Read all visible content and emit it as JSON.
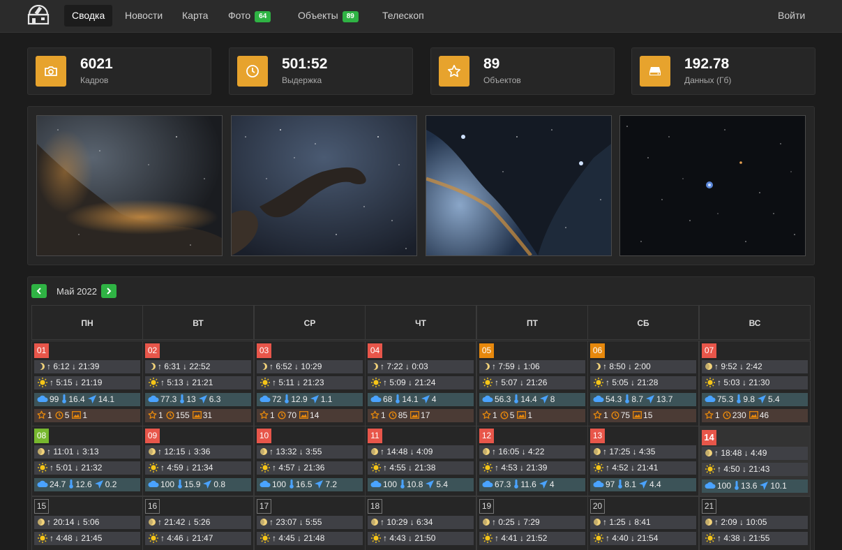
{
  "nav": {
    "items": [
      {
        "label": "Сводка",
        "active": true
      },
      {
        "label": "Новости"
      },
      {
        "label": "Карта"
      },
      {
        "label": "Фото",
        "badge": "64"
      },
      {
        "label": "Объекты",
        "badge": "89"
      },
      {
        "label": "Телескоп"
      }
    ],
    "login": "Войти"
  },
  "stats": [
    {
      "icon": "camera-icon",
      "value": "6021",
      "label": "Кадров"
    },
    {
      "icon": "clock-icon",
      "value": "501:52",
      "label": "Выдержка"
    },
    {
      "icon": "star-icon",
      "value": "89",
      "label": "Объектов"
    },
    {
      "icon": "hdd-icon",
      "value": "192.78",
      "label": "Данных (Гб)"
    }
  ],
  "gallery": [
    {
      "icon": "nebula-photo-cygnus-wall"
    },
    {
      "icon": "nebula-photo-elephant-trunk"
    },
    {
      "icon": "nebula-photo-pelican"
    },
    {
      "icon": "nebula-photo-starfield"
    }
  ],
  "calendar": {
    "month": "Май 2022",
    "weekdays": [
      "ПН",
      "ВТ",
      "СР",
      "ЧТ",
      "ПТ",
      "СБ",
      "ВС"
    ],
    "colors": {
      "accent": "#2fb344",
      "moon_row": "#3f4045",
      "weather_row": "#3c5358",
      "stats_row": "#4b3b35",
      "sun": "#f5c518",
      "cloud": "#4aa3ff",
      "star": "#e7880c"
    },
    "weeks": [
      [
        {
          "day": "01",
          "status": "red",
          "moon": "↑ 6:12 ↓ 21:39",
          "sun": "↑ 5:15 ↓ 21:19",
          "cloud": "99",
          "temp": "16.4",
          "wind": "14.1",
          "objects": "1",
          "hours": "5",
          "photos": "1"
        },
        {
          "day": "02",
          "status": "red",
          "moon": "↑ 6:31 ↓ 22:52",
          "sun": "↑ 5:13 ↓ 21:21",
          "cloud": "77.3",
          "temp": "13",
          "wind": "6.3",
          "objects": "1",
          "hours": "155",
          "photos": "31"
        },
        {
          "day": "03",
          "status": "red",
          "moon": "↑ 6:52 ↓ 10:29",
          "sun": "↑ 5:11 ↓ 21:23",
          "cloud": "72",
          "temp": "12.9",
          "wind": "1.1",
          "objects": "1",
          "hours": "70",
          "photos": "14"
        },
        {
          "day": "04",
          "status": "red",
          "moon": "↑ 7:22 ↓ 0:03",
          "sun": "↑ 5:09 ↓ 21:24",
          "cloud": "68",
          "temp": "14.1",
          "wind": "4",
          "objects": "1",
          "hours": "85",
          "photos": "17"
        },
        {
          "day": "05",
          "status": "orange",
          "moon": "↑ 7:59 ↓ 1:06",
          "sun": "↑ 5:07 ↓ 21:26",
          "cloud": "56.3",
          "temp": "14.4",
          "wind": "8",
          "objects": "1",
          "hours": "5",
          "photos": "1"
        },
        {
          "day": "06",
          "status": "orange",
          "moon": "↑ 8:50 ↓ 2:00",
          "sun": "↑ 5:05 ↓ 21:28",
          "cloud": "54.3",
          "temp": "8.7",
          "wind": "13.7",
          "objects": "1",
          "hours": "75",
          "photos": "15"
        },
        {
          "day": "07",
          "status": "red",
          "moon": "↑ 9:52 ↓ 2:42",
          "sun": "↑ 5:03 ↓ 21:30",
          "cloud": "75.3",
          "temp": "9.8",
          "wind": "5.4",
          "objects": "1",
          "hours": "230",
          "photos": "46"
        }
      ],
      [
        {
          "day": "08",
          "status": "green",
          "moon": "↑ 11:01 ↓ 3:13",
          "sun": "↑ 5:01 ↓ 21:32",
          "cloud": "24.7",
          "temp": "12.6",
          "wind": "0.2"
        },
        {
          "day": "09",
          "status": "red",
          "moon": "↑ 12:15 ↓ 3:36",
          "sun": "↑ 4:59 ↓ 21:34",
          "cloud": "100",
          "temp": "15.9",
          "wind": "0.8"
        },
        {
          "day": "10",
          "status": "red",
          "moon": "↑ 13:32 ↓ 3:55",
          "sun": "↑ 4:57 ↓ 21:36",
          "cloud": "100",
          "temp": "16.5",
          "wind": "7.2"
        },
        {
          "day": "11",
          "status": "red",
          "moon": "↑ 14:48 ↓ 4:09",
          "sun": "↑ 4:55 ↓ 21:38",
          "cloud": "100",
          "temp": "10.8",
          "wind": "5.4"
        },
        {
          "day": "12",
          "status": "red",
          "moon": "↑ 16:05 ↓ 4:22",
          "sun": "↑ 4:53 ↓ 21:39",
          "cloud": "67.3",
          "temp": "11.6",
          "wind": "4"
        },
        {
          "day": "13",
          "status": "red",
          "moon": "↑ 17:25 ↓ 4:35",
          "sun": "↑ 4:52 ↓ 21:41",
          "cloud": "97",
          "temp": "8.1",
          "wind": "4.4"
        },
        {
          "day": "14",
          "status": "today",
          "moon": "↑ 18:48 ↓ 4:49",
          "sun": "↑ 4:50 ↓ 21:43",
          "cloud": "100",
          "temp": "13.6",
          "wind": "10.1"
        }
      ],
      [
        {
          "day": "15",
          "status": "plain",
          "moon": "↑ 20:14 ↓ 5:06",
          "sun": "↑ 4:48 ↓ 21:45"
        },
        {
          "day": "16",
          "status": "plain",
          "moon": "↑ 21:42 ↓ 5:26",
          "sun": "↑ 4:46 ↓ 21:47"
        },
        {
          "day": "17",
          "status": "plain",
          "moon": "↑ 23:07 ↓ 5:55",
          "sun": "↑ 4:45 ↓ 21:48"
        },
        {
          "day": "18",
          "status": "plain",
          "moon": "↑ 10:29 ↓ 6:34",
          "sun": "↑ 4:43 ↓ 21:50"
        },
        {
          "day": "19",
          "status": "plain",
          "moon": "↑ 0:25 ↓ 7:29",
          "sun": "↑ 4:41 ↓ 21:52"
        },
        {
          "day": "20",
          "status": "plain",
          "moon": "↑ 1:25 ↓ 8:41",
          "sun": "↑ 4:40 ↓ 21:54"
        },
        {
          "day": "21",
          "status": "plain",
          "moon": "↑ 2:09 ↓ 10:05",
          "sun": "↑ 4:38 ↓ 21:55"
        }
      ]
    ]
  }
}
